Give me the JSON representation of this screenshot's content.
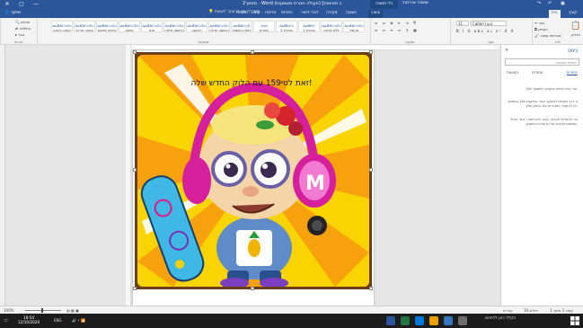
{
  "window": {
    "title": "מסמך2 - Word (פעולה חסרת משמעות) [מצב תאימות]",
    "context_tab_group": "כלי תמונה",
    "user": "שושנה אברמוב",
    "controls": [
      "close",
      "maximize",
      "minimize"
    ],
    "quick_access": [
      "save-icon",
      "undo-icon",
      "redo-icon"
    ]
  },
  "tabs": [
    "קובץ",
    "בית",
    "הוספה",
    "עיצוב",
    "פריסה",
    "הפניות",
    "דברי דואר",
    "סקירה",
    "תצוגה",
    "עיצוב"
  ],
  "active_tab_index": 1,
  "tell_me": "ספר לי מה ברצונך לעשות...",
  "share": "שיתוף",
  "ribbon": {
    "clipboard_label": "לוח",
    "paste_label": "הדבק",
    "cut": "גזור",
    "copy": "העתק",
    "format_painter": "מברשת עיצוב",
    "font_label": "גופן",
    "font_name": "Calibri (גוף)",
    "font_size": "11",
    "paragraph_label": "פסקה",
    "styles_label": "סגנונות",
    "styles": [
      {
        "preview": "AaBbCcDc",
        "name": "נורמלי"
      },
      {
        "preview": "AaBbCcDc",
        "name": "ללא מרווח"
      },
      {
        "preview": "AaBbC",
        "name": "כותרת 1"
      },
      {
        "preview": "AaBbCc",
        "name": "כותרת 2"
      },
      {
        "preview": "אבגד",
        "name": "כותרת"
      },
      {
        "preview": "AaBbCcD",
        "name": "כותרת משנה"
      },
      {
        "preview": "AaBbCcDc",
        "name": "הדגשה עדינה"
      },
      {
        "preview": "AaBbCcDc",
        "name": "הדגשה"
      },
      {
        "preview": "AaBbCcDc",
        "name": "הדגשה חזקה"
      },
      {
        "preview": "AaBbCcDc",
        "name": "חזק"
      },
      {
        "preview": "AaBbCcDc",
        "name": "ציטוט"
      },
      {
        "preview": "AaBbCcDc",
        "name": "ציטוט מודגש"
      },
      {
        "preview": "AaBbCcDc",
        "name": "הפניה עדינה"
      },
      {
        "preview": "AaBbCcDc",
        "name": "הפניה חזקה"
      }
    ],
    "editing_label": "עריכה",
    "find": "חיפוש",
    "replace": "החלפה",
    "select": "בחר"
  },
  "document": {
    "caption": "זאת לטי159 עם הלוק החדש שלה!"
  },
  "pane": {
    "title": "ניווט",
    "search_placeholder": "חיפוש במסמך",
    "tabs": [
      "כותרות",
      "עמודים",
      "תוצאות"
    ],
    "active_tab": 0,
    "text_1": "צור ניווט אינטראקטיבי למסמך שלך.",
    "text_2": "זו דרך מצוינת למעקב אחר המיקום שלך במסמך או להעביר במהירות את התוכן שלך.",
    "text_3": "כדי להתחיל לעבוד, עבור לכרטיסיה 'בית' והחל סגנונות כותרת על הכותרות במסמך."
  },
  "status": {
    "page": "עמוד 1 מתוך 1",
    "words": "10 מילים",
    "language": "עברית",
    "zoom": "100%"
  },
  "taskbar": {
    "search": "הקלד כאן לחיפוש",
    "time": "18:54",
    "date": "12/10/2020",
    "language": "ENG"
  }
}
